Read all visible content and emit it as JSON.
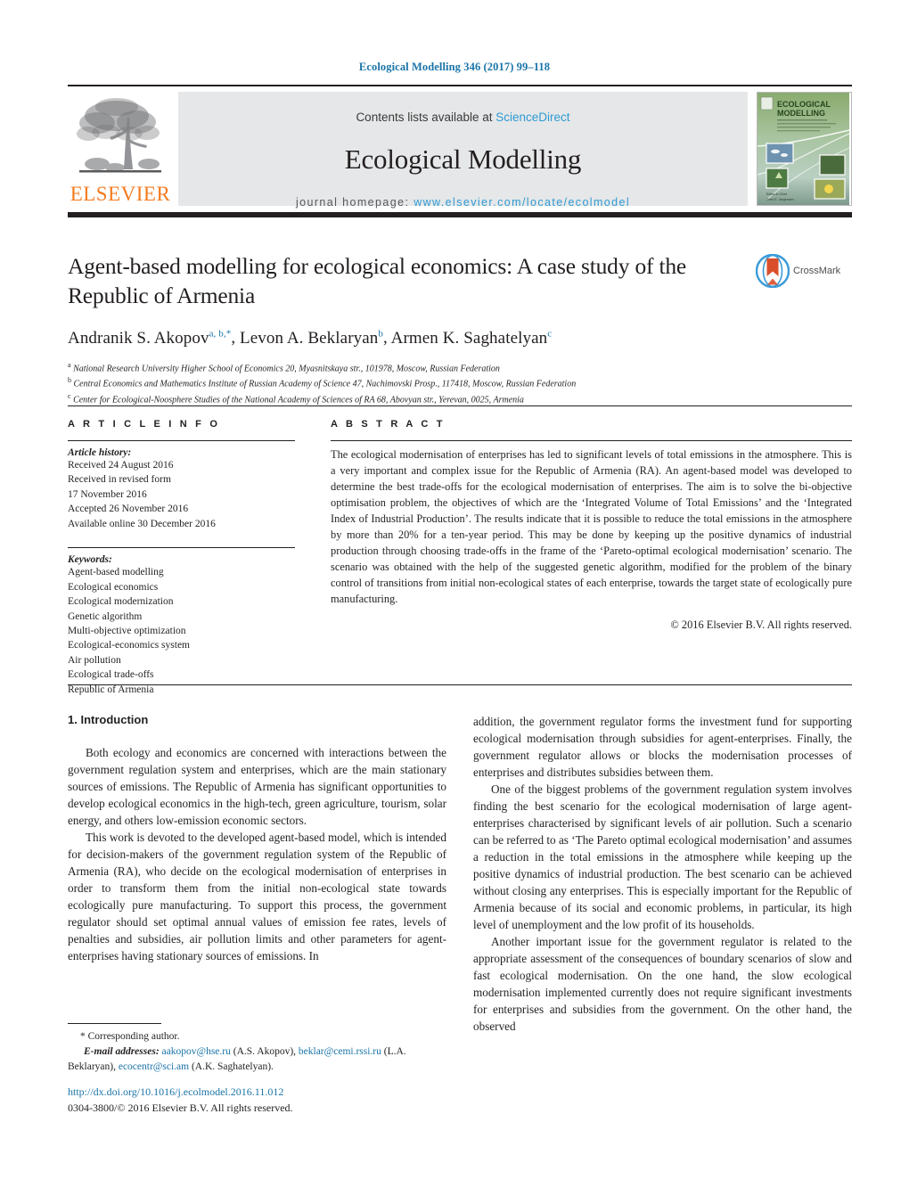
{
  "running_head": "Ecological Modelling 346 (2017) 99–118",
  "masthead": {
    "contents_prefix": "Contents lists available at ",
    "sciencedirect": "ScienceDirect",
    "journal_name": "Ecological Modelling",
    "homepage_prefix": "journal homepage: ",
    "homepage_url": "www.elsevier.com/locate/ecolmodel",
    "publisher": "ELSEVIER",
    "cover_title_line1": "ECOLOGICAL",
    "cover_title_line2": "MODELLING",
    "accent_blue": "#2e9bd4",
    "publisher_orange": "#f47b20"
  },
  "article": {
    "title": "Agent-based modelling for ecological economics: A case study of the Republic of Armenia",
    "crossmark_label": "CrossMark",
    "authors": [
      {
        "name": "Andranik S. Akopov",
        "sup": "a, b,",
        "star": "*"
      },
      {
        "name": "Levon A. Beklaryan",
        "sup": "b"
      },
      {
        "name": "Armen K. Saghatelyan",
        "sup": "c"
      }
    ],
    "affiliations": [
      {
        "mark": "a",
        "text": "National Research University Higher School of Economics 20, Myasnitskaya str., 101978, Moscow, Russian Federation"
      },
      {
        "mark": "b",
        "text": "Central Economics and Mathematics Institute of Russian Academy of Science 47, Nachimovski Prosp., 117418, Moscow, Russian Federation"
      },
      {
        "mark": "c",
        "text": "Center for Ecological-Noosphere Studies of the National Academy of Sciences of RA 68, Abovyan str., Yerevan, 0025, Armenia"
      }
    ]
  },
  "article_info": {
    "heading": "A R T I C L E   I N F O",
    "history_label": "Article history:",
    "history": [
      "Received 24 August 2016",
      "Received in revised form",
      "17 November 2016",
      "Accepted 26 November 2016",
      "Available online 30 December 2016"
    ],
    "keywords_label": "Keywords:",
    "keywords": [
      "Agent-based modelling",
      "Ecological economics",
      "Ecological modernization",
      "Genetic algorithm",
      "Multi-objective optimization",
      "Ecological-economics system",
      "Air pollution",
      "Ecological trade-offs",
      "Republic of Armenia"
    ]
  },
  "abstract": {
    "heading": "A B S T R A C T",
    "text": "The ecological modernisation of enterprises has led to significant levels of total emissions in the atmosphere. This is a very important and complex issue for the Republic of Armenia (RA). An agent-based model was developed to determine the best trade-offs for the ecological modernisation of enterprises. The aim is to solve the bi-objective optimisation problem, the objectives of which are the ‘Integrated Volume of Total Emissions’ and the ‘Integrated Index of Industrial Production’. The results indicate that it is possible to reduce the total emissions in the atmosphere by more than 20% for a ten-year period. This may be done by keeping up the positive dynamics of industrial production through choosing trade-offs in the frame of the ‘Pareto-optimal ecological modernisation’ scenario. The scenario was obtained with the help of the suggested genetic algorithm, modified for the problem of the binary control of transitions from initial non-ecological states of each enterprise, towards the target state of ecologically pure manufacturing.",
    "copyright": "© 2016 Elsevier B.V. All rights reserved."
  },
  "body": {
    "section_title": "1.  Introduction",
    "left_paragraphs": [
      "Both ecology and economics are concerned with interactions between the government regulation system and enterprises, which are the main stationary sources of emissions. The Republic of Armenia has significant opportunities to develop ecological economics in the high-tech, green agriculture, tourism, solar energy, and others low-emission economic sectors.",
      "This work is devoted to the developed agent-based model, which is intended for decision-makers of the government regulation system of the Republic of Armenia (RA), who decide on the ecological modernisation of enterprises in order to transform them from the initial non-ecological state towards ecologically pure manufacturing. To support this process, the government regulator should set optimal annual values of emission fee rates, levels of penalties and subsidies, air pollution limits and other parameters for agent-enterprises having stationary sources of emissions. In"
    ],
    "right_paragraphs": [
      "addition, the government regulator forms the investment fund for supporting ecological modernisation through subsidies for agent-enterprises. Finally, the government regulator allows or blocks the modernisation processes of enterprises and distributes subsidies between them.",
      "One of the biggest problems of the government regulation system involves finding the best scenario for the ecological modernisation of large agent-enterprises characterised by significant levels of air pollution. Such a scenario can be referred to as ‘The Pareto optimal ecological modernisation’ and assumes a reduction in the total emissions in the atmosphere while keeping up the positive dynamics of industrial production. The best scenario can be achieved without closing any enterprises. This is especially important for the Republic of Armenia because of its social and economic problems, in particular, its high level of unemployment and the low profit of its households.",
      "Another important issue for the government regulator is related to the appropriate assessment of the consequences of boundary scenarios of slow and fast ecological modernisation. On the one hand, the slow ecological modernisation implemented currently does not require significant investments for enterprises and subsidies from the government. On the other hand, the observed"
    ]
  },
  "footer": {
    "corresponding_author": "* Corresponding author.",
    "email_label": "E-mail addresses:",
    "emails": [
      {
        "address": "aakopov@hse.ru",
        "person": "(A.S. Akopov),"
      },
      {
        "address": "beklar@cemi.rssi.ru",
        "person": "(L.A. Beklaryan),"
      },
      {
        "address": "ecocentr@sci.am",
        "person": "(A.K. Saghatelyan)."
      }
    ],
    "doi": "http://dx.doi.org/10.1016/j.ecolmodel.2016.11.012",
    "issn_copyright": "0304-3800/© 2016 Elsevier B.V. All rights reserved."
  }
}
